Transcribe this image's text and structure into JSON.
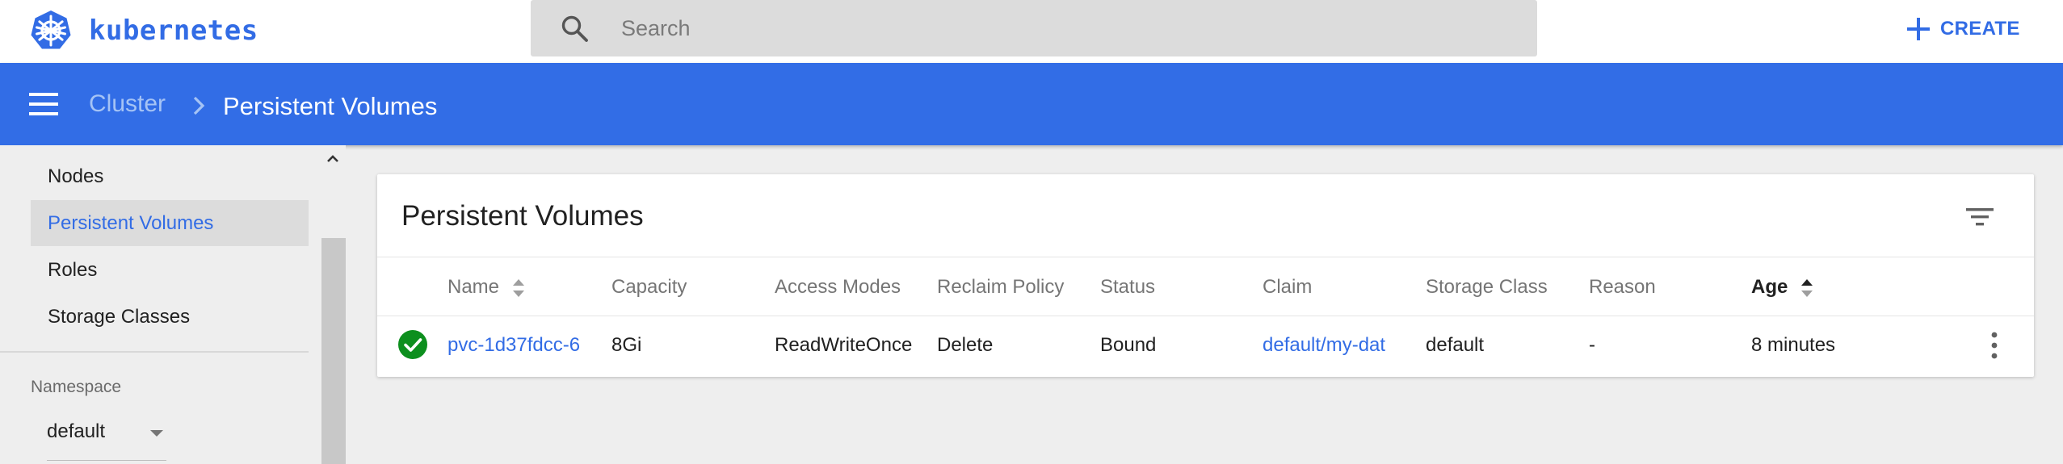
{
  "header": {
    "brand_name": "kubernetes",
    "logo_icon": "kubernetes-helm-icon",
    "search": {
      "placeholder": "Search",
      "value": "",
      "icon": "search-icon"
    },
    "create_label": "CREATE",
    "create_icon": "plus-icon"
  },
  "navbar": {
    "menu_icon": "hamburger-menu-icon",
    "breadcrumb": {
      "parent": "Cluster",
      "separator_icon": "chevron-right-icon",
      "current": "Persistent Volumes"
    }
  },
  "sidebar": {
    "items": [
      {
        "label": "Nodes",
        "active": false
      },
      {
        "label": "Persistent Volumes",
        "active": true
      },
      {
        "label": "Roles",
        "active": false
      },
      {
        "label": "Storage Classes",
        "active": false
      }
    ],
    "namespace": {
      "label": "Namespace",
      "value": "default",
      "dropdown_icon": "caret-down-icon"
    },
    "scroll_up_icon": "chevron-up-icon"
  },
  "card": {
    "title": "Persistent Volumes",
    "filter_icon": "filter-list-icon",
    "columns": [
      "Name",
      "Capacity",
      "Access Modes",
      "Reclaim Policy",
      "Status",
      "Claim",
      "Storage Class",
      "Reason",
      "Age"
    ],
    "sortable_columns": [
      "Name",
      "Age"
    ],
    "sorted_column": "Age",
    "rows": [
      {
        "status_icon": "check-circle-icon",
        "status_color": "#0d8f1e",
        "name": "pvc-1d37fdcc-6",
        "capacity": "8Gi",
        "access_modes": "ReadWriteOnce",
        "reclaim_policy": "Delete",
        "status": "Bound",
        "claim": "default/my-dat",
        "storage_class": "default",
        "reason": "-",
        "age": "8 minutes",
        "menu_icon": "more-vertical-icon"
      }
    ]
  },
  "colors": {
    "accent": "#326ce5",
    "navbar": "#326de6",
    "success": "#0d8f1e"
  }
}
